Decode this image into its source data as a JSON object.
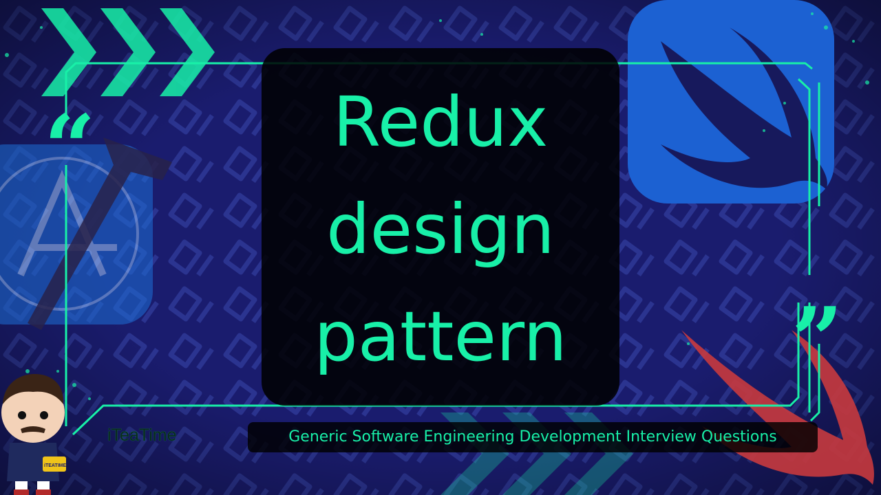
{
  "title_lines": [
    "Redux",
    "design",
    "pattern"
  ],
  "quotes": {
    "open": "“",
    "close": "”"
  },
  "brand": "iTeaTime",
  "subtitle": "Generic Software Engineering Development Interview Questions",
  "mascot_badge": "iTEATIME",
  "icons": {
    "left": "xcode-icon",
    "top_right": "swift-logo-icon",
    "bottom_right": "swift-bird-icon",
    "arrows": "chevron-right-icon",
    "mascot": "ted-lasso-figure-icon"
  },
  "colors": {
    "background": "#1a1c6e",
    "accent": "#18f0a8",
    "card": "#000000",
    "swift_red": "#d23a3a",
    "swift_blue": "#1e6fd8"
  }
}
